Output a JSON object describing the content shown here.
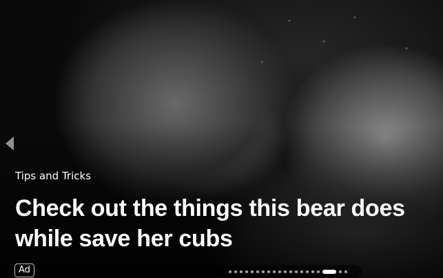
{
  "card": {
    "category": "Tips and Tricks",
    "headline": "Check out the things this bear does while save her cubs",
    "ad_label": "Ad"
  },
  "carousel": {
    "prev_icon": "chevron-left-icon",
    "slide_count": 20,
    "active_index": 17
  }
}
